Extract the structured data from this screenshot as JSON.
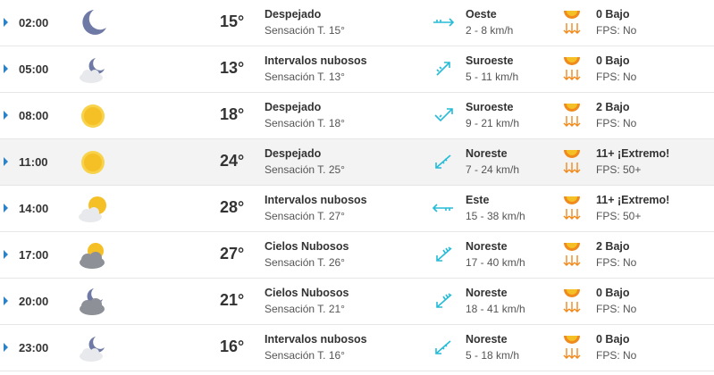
{
  "rows": [
    {
      "time": "02:00",
      "icon": "moon-icon",
      "temp": "15°",
      "condition": "Despejado",
      "feels": "Sensación T. 15°",
      "wind_icon": "wind-west-icon",
      "wind_dir": "Oeste",
      "wind_speed": "2 - 8 km/h",
      "uv": "0 Bajo",
      "fps": "FPS: No"
    },
    {
      "time": "05:00",
      "icon": "moon-cloud-icon",
      "temp": "13°",
      "condition": "Intervalos nubosos",
      "feels": "Sensación T. 13°",
      "wind_icon": "wind-southwest-icon",
      "wind_dir": "Suroeste",
      "wind_speed": "5 - 11 km/h",
      "uv": "0 Bajo",
      "fps": "FPS: No"
    },
    {
      "time": "08:00",
      "icon": "sun-icon",
      "temp": "18°",
      "condition": "Despejado",
      "feels": "Sensación T. 18°",
      "wind_icon": "wind-southwest-icon",
      "wind_dir": "Suroeste",
      "wind_speed": "9 - 21 km/h",
      "uv": "2 Bajo",
      "fps": "FPS: No"
    },
    {
      "time": "11:00",
      "icon": "sun-icon",
      "temp": "24°",
      "condition": "Despejado",
      "feels": "Sensación T. 25°",
      "wind_icon": "wind-northeast-icon",
      "wind_dir": "Noreste",
      "wind_speed": "7 - 24 km/h",
      "uv": "11+ ¡Extremo!",
      "fps": "FPS: 50+"
    },
    {
      "time": "14:00",
      "icon": "sun-cloud-icon",
      "temp": "28°",
      "condition": "Intervalos nubosos",
      "feels": "Sensación T. 27°",
      "wind_icon": "wind-east-icon",
      "wind_dir": "Este",
      "wind_speed": "15 - 38 km/h",
      "uv": "11+ ¡Extremo!",
      "fps": "FPS: 50+"
    },
    {
      "time": "17:00",
      "icon": "sun-grey-cloud-icon",
      "temp": "27°",
      "condition": "Cielos Nubosos",
      "feels": "Sensación T. 26°",
      "wind_icon": "wind-northeast-icon",
      "wind_dir": "Noreste",
      "wind_speed": "17 - 40 km/h",
      "uv": "2 Bajo",
      "fps": "FPS: No"
    },
    {
      "time": "20:00",
      "icon": "moon-grey-cloud-icon",
      "temp": "21°",
      "condition": "Cielos Nubosos",
      "feels": "Sensación T. 21°",
      "wind_icon": "wind-northeast-icon",
      "wind_dir": "Noreste",
      "wind_speed": "18 - 41 km/h",
      "uv": "0 Bajo",
      "fps": "FPS: No"
    },
    {
      "time": "23:00",
      "icon": "moon-cloud-icon",
      "temp": "16°",
      "condition": "Intervalos nubosos",
      "feels": "Sensación T. 16°",
      "wind_icon": "wind-northeast-icon",
      "wind_dir": "Noreste",
      "wind_speed": "5 - 18 km/h",
      "uv": "0 Bajo",
      "fps": "FPS: No"
    }
  ],
  "highlighted_row": 3,
  "colors": {
    "accent": "#2a82c9",
    "wind": "#26bcd7",
    "sun": "#f5c026",
    "uv": "#f08a1c",
    "moon": "#6e79a6",
    "cloud": "#b9bcc2"
  }
}
